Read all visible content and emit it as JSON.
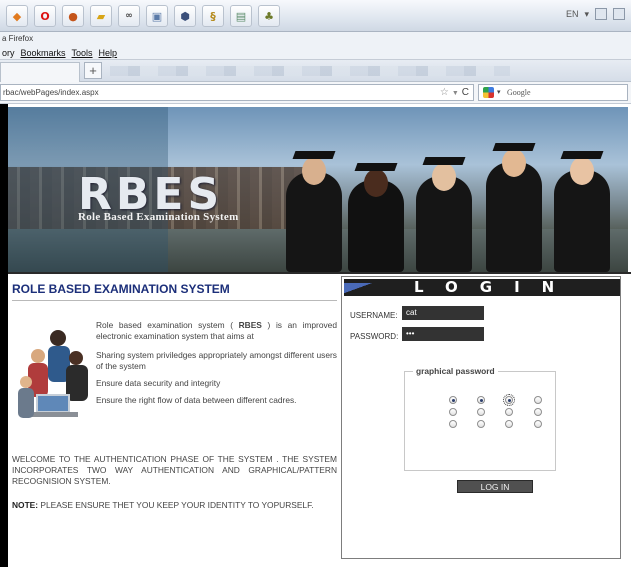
{
  "browser": {
    "window_title": "a Firefox",
    "menus": [
      "ory",
      "Bookmarks",
      "Tools",
      "Help"
    ],
    "new_tab_symbol": "+",
    "url": "rbac/webPages/index.aspx",
    "search_engine": "Google",
    "tray_language": "EN",
    "taskbar_icons": [
      "orange-icon",
      "opera-icon",
      "shield-icon",
      "folder-icon",
      "glasses-icon",
      "window-icon",
      "cube-icon",
      "pdf-icon",
      "notepad-icon",
      "puzzle-icon"
    ]
  },
  "banner": {
    "logo": "RBES",
    "subtitle": "Role Based Examination System"
  },
  "main": {
    "title": "ROLE BASED EXAMINATION SYSTEM",
    "bullets": [
      {
        "prefix": "Role based examination system ( ",
        "bold": "RBES",
        "suffix": " ) is an improved electronic examination  system that aims at"
      },
      {
        "text": "Sharing system priviledges appropriately amongst different users of the system"
      },
      {
        "text": "Ensure data security and integrity"
      },
      {
        "text": "Ensure the right flow of data between different cadres."
      }
    ],
    "welcome": "WELCOME TO THE AUTHENTICATION PHASE OF THE SYSTEM . THE SYSTEM INCORPORATES TWO WAY AUTHENTICATION AND GRAPHICAL/PATTERN RECOGNISION SYSTEM.",
    "note_label": "NOTE:",
    "note_text": " PLEASE ENSURE THET YOU KEEP YOUR IDENTITY TO YOPURSELF."
  },
  "login": {
    "title": "LOGIN",
    "username_label": "USERNAME:",
    "username_value": "cat",
    "password_label": "PASSWORD:",
    "password_value": "•••",
    "graphical_label": "graphical password",
    "radio_grid": [
      [
        true,
        true,
        true,
        false
      ],
      [
        false,
        false,
        false,
        false
      ],
      [
        false,
        false,
        false,
        false
      ]
    ],
    "button_label": "LOG IN"
  }
}
